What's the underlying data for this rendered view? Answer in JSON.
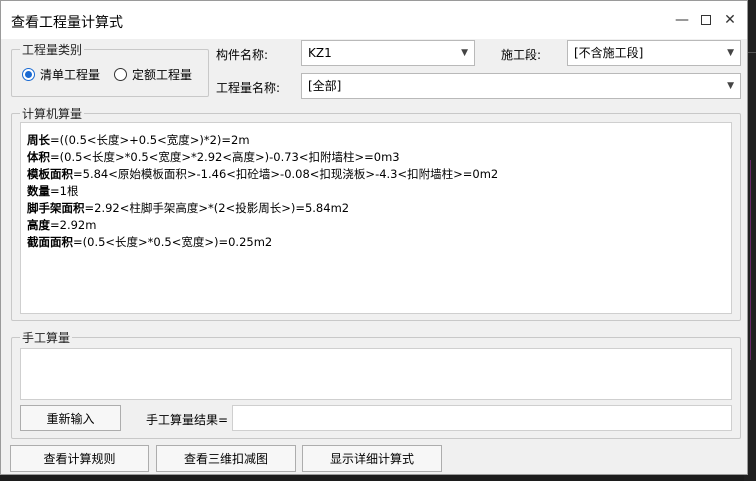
{
  "window": {
    "title": "查看工程量计算式",
    "minimize_glyph": "—",
    "close_glyph": "✕"
  },
  "qty_type": {
    "label": "工程量类别",
    "options": [
      "清单工程量",
      "定额工程量"
    ],
    "selected": "清单工程量"
  },
  "component": {
    "label": "构件名称:",
    "value": "KZ1"
  },
  "stage": {
    "label": "施工段:",
    "value": "[不含施工段]"
  },
  "qty_name": {
    "label": "工程量名称:",
    "value": "[全部]"
  },
  "calc": {
    "label": "计算机算量",
    "lines": [
      {
        "name": "周长",
        "expr": "=((0.5<长度>+0.5<宽度>)*2)=2m"
      },
      {
        "name": "体积",
        "expr": "=(0.5<长度>*0.5<宽度>*2.92<高度>)-0.73<扣附墙柱>=0m3"
      },
      {
        "name": "模板面积",
        "expr": "=5.84<原始模板面积>-1.46<扣砼墙>-0.08<扣现浇板>-4.3<扣附墙柱>=0m2"
      },
      {
        "name": "数量",
        "expr": "=1根"
      },
      {
        "name": "脚手架面积",
        "expr": "=2.92<柱脚手架高度>*(2<投影周长>)=5.84m2"
      },
      {
        "name": "高度",
        "expr": "=2.92m"
      },
      {
        "name": "截面面积",
        "expr": "=(0.5<长度>*0.5<宽度>)=0.25m2"
      }
    ]
  },
  "manual": {
    "label": "手工算量",
    "reinput_button": "重新输入",
    "result_label": "手工算量结果=",
    "result_value": ""
  },
  "buttons": {
    "view_rules": "查看计算规则",
    "view_3d": "查看三维扣减图",
    "show_detail": "显示详细计算式"
  }
}
